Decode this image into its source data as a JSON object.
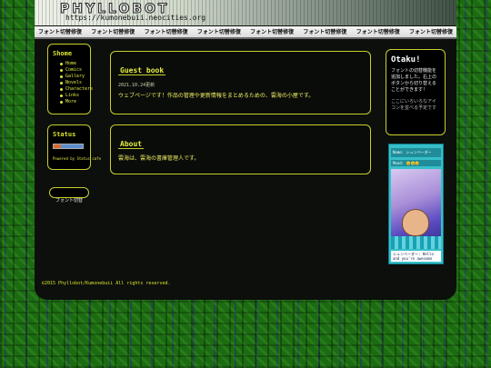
{
  "header": {
    "logo_text": "PHYLLOBOT",
    "url": "https://kumonebuii.neocities.org"
  },
  "nav": {
    "items": [
      "フォント切替修復",
      "フォント切替修復",
      "フォント切替修復",
      "フォント切替修復",
      "フォント切替修復",
      "フォント切替修復",
      "フォント切替修復",
      "フォント切替修復"
    ]
  },
  "sidebar": {
    "menu_title": "Shome",
    "menu_items": [
      "Home",
      "Comics",
      "Gallery",
      "Novels",
      "Characters",
      "Links",
      "More"
    ],
    "status_title": "Status",
    "status_powered": "Powered by Status cafe",
    "font_button": "フォント切替"
  },
  "guestbook": {
    "title": "Guest book",
    "date": "2021.10.24更新",
    "text": "ウェブページです！作品の管理や更新情報をまとめるための、雲海の小屋です。"
  },
  "about": {
    "title": "About",
    "text": "雲海は、雲海の書庫管理人です。"
  },
  "right_panel": {
    "title": "Otaku!",
    "text": "フォントの切替機能を追加しました。右上のボタンから切り替えることができます！",
    "subtext": "ここにいろいろなアイコンを並べる予定です"
  },
  "widget": {
    "name_label": "Name: シュンベーダー",
    "mood_label": "Mood:",
    "mood_value": "😊😊😊",
    "message": "シュンベーダー: Hello and you're awesome"
  },
  "footer": {
    "copyright": "©2015 Phyllobot/Kumonebuii All rights reserved."
  },
  "colors": {
    "accent_yellow": "#d9e22a",
    "frame_dark": "#0c0f0c",
    "widget_cyan": "#37bfc9"
  }
}
